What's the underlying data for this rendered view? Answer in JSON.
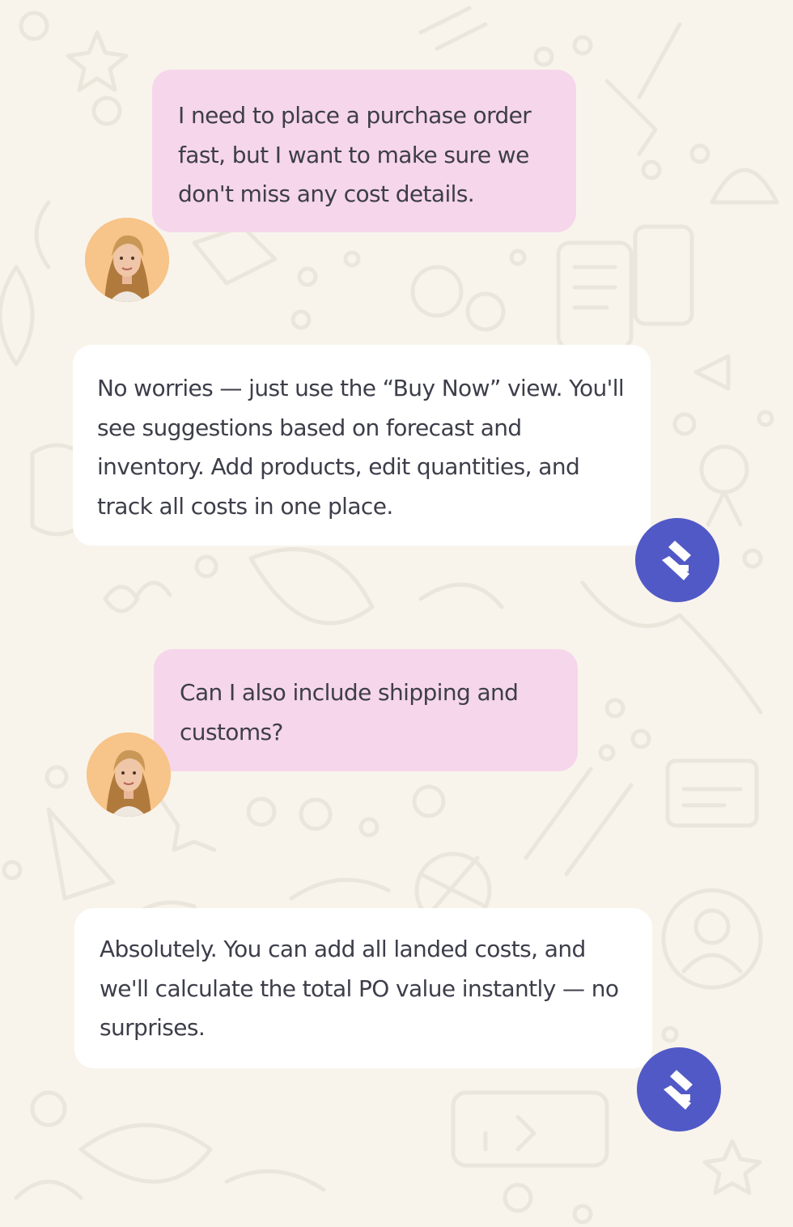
{
  "colors": {
    "background": "#f8f4ec",
    "doodle_stroke": "#ebe6dc",
    "user_bubble": "#f6d6ea",
    "bot_bubble": "#ffffff",
    "bot_avatar": "#5159c6",
    "user_avatar_bg": "#f7c489",
    "text": "#3d3e4a"
  },
  "chat": {
    "messages": [
      {
        "sender": "user",
        "text": "I need to place a purchase order fast, but I want to make sure we don't miss any cost details.",
        "avatar": "user-photo"
      },
      {
        "sender": "bot",
        "text": "No worries — just use the “Buy Now” view. You'll see suggestions based on forecast and inventory. Add products, edit quantities, and track all costs in one place.",
        "avatar": "brand-logo-icon"
      },
      {
        "sender": "user",
        "text": "Can I also include shipping and customs?",
        "avatar": "user-photo"
      },
      {
        "sender": "bot",
        "text": "Absolutely. You can add all landed costs, and we'll calculate the total PO value instantly — no surprises.",
        "avatar": "brand-logo-icon"
      }
    ]
  }
}
